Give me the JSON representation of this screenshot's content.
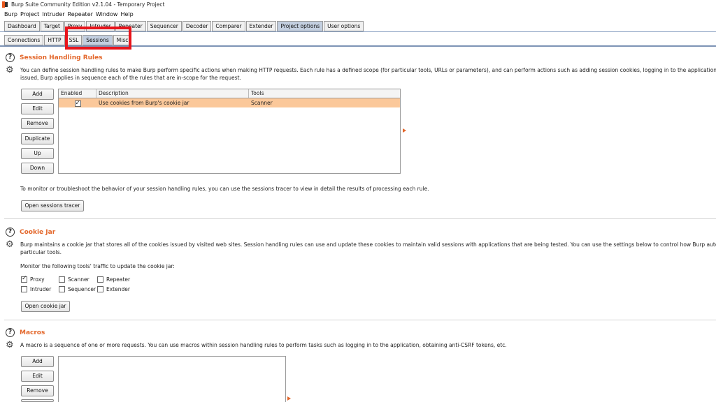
{
  "window": {
    "title": "Burp Suite Community Edition v2.1.04 - Temporary Project"
  },
  "menu": [
    "Burp",
    "Project",
    "Intruder",
    "Repeater",
    "Window",
    "Help"
  ],
  "main_tabs": [
    "Dashboard",
    "Target",
    "Proxy",
    "Intruder",
    "Repeater",
    "Sequencer",
    "Decoder",
    "Comparer",
    "Extender",
    "Project options",
    "User options"
  ],
  "main_active": "Project options",
  "sub_tabs": [
    "Connections",
    "HTTP",
    "SSL",
    "Sessions",
    "Misc"
  ],
  "sub_active": "Sessions",
  "session_rules": {
    "title": "Session Handling Rules",
    "description_line1": "You can define session handling rules to make Burp perform specific actions when making HTTP requests. Each rule has a defined scope (for particular tools, URLs or parameters), and can perform actions such as adding session cookies, logging in to the application, or checking se",
    "description_line2": "issued, Burp applies in sequence each of the rules that are in-scope for the request.",
    "buttons": [
      "Add",
      "Edit",
      "Remove",
      "Duplicate",
      "Up",
      "Down"
    ],
    "columns": [
      "Enabled",
      "Description",
      "Tools"
    ],
    "rows": [
      {
        "enabled": true,
        "description": "Use cookies from Burp's cookie jar",
        "tools": "Scanner"
      }
    ],
    "tracer_text": "To monitor or troubleshoot the behavior of your session handling rules, you can use the sessions tracer to view in detail the results of processing each rule.",
    "tracer_button": "Open sessions tracer"
  },
  "cookie_jar": {
    "title": "Cookie Jar",
    "description_line1": "Burp maintains a cookie jar that stores all of the cookies issued by visited web sites. Session handling rules can use and update these cookies to maintain valid sessions with applications that are being tested. You can use the settings below to control how Burp automatically update",
    "description_line2": "particular tools.",
    "monitor_label": "Monitor the following tools' traffic to update the cookie jar:",
    "tools": [
      {
        "label": "Proxy",
        "checked": true
      },
      {
        "label": "Scanner",
        "checked": false
      },
      {
        "label": "Repeater",
        "checked": false
      },
      {
        "label": "Intruder",
        "checked": false
      },
      {
        "label": "Sequencer",
        "checked": false
      },
      {
        "label": "Extender",
        "checked": false
      }
    ],
    "open_button": "Open cookie jar"
  },
  "macros": {
    "title": "Macros",
    "description": "A macro is a sequence of one or more requests. You can use macros within session handling rules to perform tasks such as logging in to the application, obtaining anti-CSRF tokens, etc.",
    "buttons": [
      "Add",
      "Edit",
      "Remove"
    ]
  },
  "colors": {
    "accent": "#e3672b",
    "selected_row": "#fbc89a",
    "highlight": "#e8141b",
    "active_tab": "#c3cfe0"
  }
}
